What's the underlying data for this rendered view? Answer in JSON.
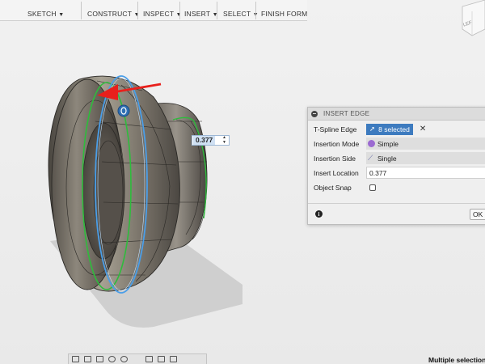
{
  "toolbar": {
    "items": [
      {
        "label": "SKETCH",
        "icon": "sketch-icon"
      },
      {
        "label": "CONSTRUCT",
        "icon": "construct-plane-icon"
      },
      {
        "label": "INSPECT",
        "icon": "measure-icon"
      },
      {
        "label": "INSERT",
        "icon": "insert-image-icon"
      },
      {
        "label": "SELECT",
        "icon": "cursor-icon"
      },
      {
        "label": "FINISH FORM",
        "icon": "finish-form-icon"
      }
    ],
    "caret": "▼"
  },
  "viewcube": {
    "face_label": "LEF"
  },
  "dialog": {
    "title": "INSERT EDGE",
    "rows": {
      "tspline_edge": {
        "label": "T-Spline Edge",
        "value": "8 selected",
        "clear": "✕"
      },
      "insertion_mode": {
        "label": "Insertion Mode",
        "value": "Simple"
      },
      "insertion_side": {
        "label": "Insertion Side",
        "value": "Single"
      },
      "insert_location": {
        "label": "Insert Location",
        "value": "0.377"
      },
      "object_snap": {
        "label": "Object Snap",
        "checked": false
      }
    },
    "info_glyph": "i",
    "ok_label": "OK"
  },
  "viewport": {
    "value_input": "0.377",
    "spin_up": "▲",
    "spin_down": "▼"
  },
  "status": {
    "text": "Multiple selections"
  },
  "colors": {
    "selection_blue": "#3d7bbf",
    "edge_green": "#2ebc3c",
    "edge_blue": "#4a9ee8",
    "arrow_red": "#e8201c"
  }
}
